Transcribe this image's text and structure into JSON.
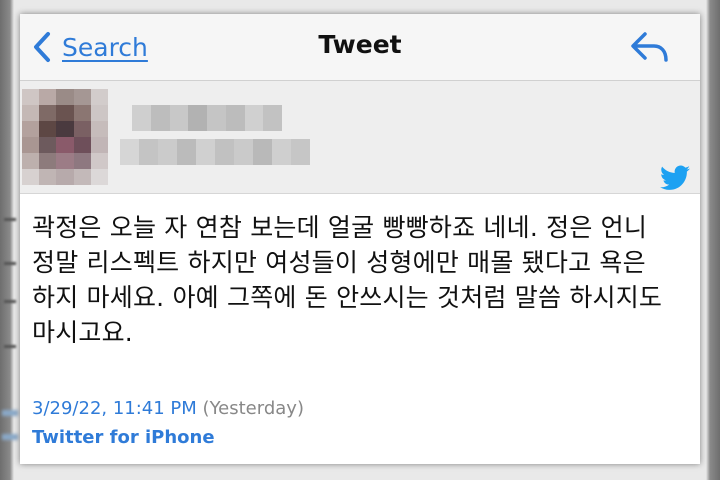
{
  "nav": {
    "back_label": "Search",
    "title": "Tweet"
  },
  "tweet": {
    "text": "곽정은 오늘 자 연참 보는데 얼굴 빵빵하죠 네네. 정은 언니 정말 리스펙트 하지만 여성들이 성형에만 매몰 됐다고 욕은 하지 마세요. 아예 그쪽에 돈 안쓰시는 것처럼 말씀 하시지도 마시고요.",
    "timestamp": "3/29/22, 11:41 PM",
    "relative_time": "(Yesterday)",
    "source": "Twitter for iPhone"
  },
  "colors": {
    "accent": "#2f7bd8",
    "twitter_blue": "#1da1f2",
    "nav_bg": "#f6f6f6",
    "header_bg": "#eeeeee"
  },
  "icons": {
    "back": "chevron-left-icon",
    "reply": "reply-icon",
    "brand": "twitter-bird-icon"
  }
}
